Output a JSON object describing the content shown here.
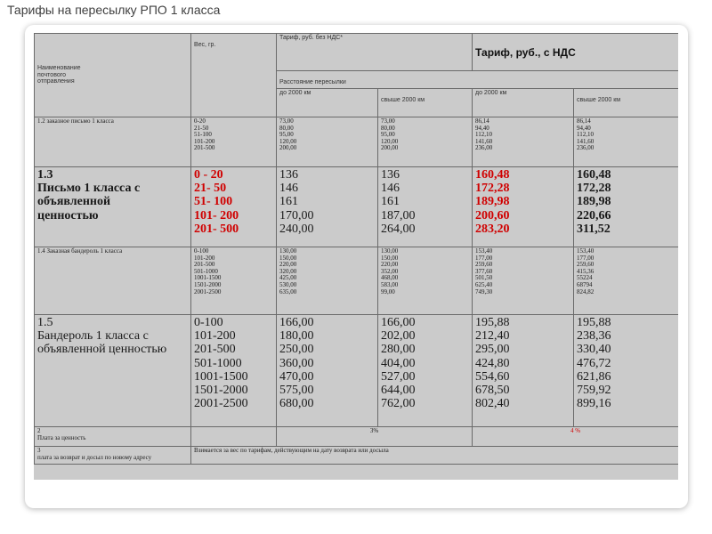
{
  "title": "Тарифы на пересылку РПО 1 класса",
  "header": {
    "name_col": "Наименование почтового отправления",
    "weight_col": "Вес, гр.",
    "tariff_no_vat": "Тариф, руб. без НДС*",
    "tariff_vat": "Тариф, руб., с НДС",
    "distance": "Расстояние пересылки",
    "d1": "до 2000 км",
    "d2": "свыше 2000 км",
    "d3": "до 2000 км",
    "d4": "свыше 2000 км"
  },
  "rows": {
    "r12": {
      "name": "1.2 заказное письмо 1 класса",
      "weights": [
        "0-20",
        "21-50",
        "51-100",
        "101-200",
        "201-500"
      ],
      "c1": [
        "73,00",
        "80,00",
        "95,00",
        "120,00",
        "200,00"
      ],
      "c2": [
        "73,00",
        "80,00",
        "95,00",
        "120,00",
        "200,00"
      ],
      "c3": [
        "86,14",
        "94,40",
        "112,10",
        "141,60",
        "236,00"
      ],
      "c4": [
        "86,14",
        "94,40",
        "112,10",
        "141,60",
        "236,00"
      ]
    },
    "r13": {
      "num": "1.3",
      "name": "Письмо 1 класса с объявленной ценностью",
      "weights": [
        "0 - 20",
        "21- 50",
        "51- 100",
        "101- 200",
        "201- 500"
      ],
      "c1": [
        "136",
        "146",
        "161",
        "170,00",
        "240,00"
      ],
      "c2": [
        "136",
        "146",
        "161",
        "187,00",
        "264,00"
      ],
      "c3": [
        "160,48",
        "172,28",
        "189,98",
        "200,60",
        "283,20"
      ],
      "c4": [
        "160,48",
        "172,28",
        "189,98",
        "220,66",
        "311,52"
      ]
    },
    "r14": {
      "name": "1.4 Заказная бандероль 1 класса",
      "weights": [
        "0-100",
        "101-200",
        "201-500",
        "501-1000",
        "1001-1500",
        "1501-2000",
        "2001-2500"
      ],
      "c1": [
        "130,00",
        "150,00",
        "220,00",
        "320,00",
        "425,00",
        "530,00",
        "635,00"
      ],
      "c2": [
        "130,00",
        "150,00",
        "220,00",
        "352,00",
        "468,00",
        "583,00",
        "99,00"
      ],
      "c3": [
        "153,40",
        "177,00",
        "259,60",
        "377,60",
        "501,50",
        "625,40",
        "749,30"
      ],
      "c4": [
        "153,40",
        "177,00",
        "259,60",
        "415,36",
        "55224",
        "68794",
        "824,82"
      ]
    },
    "r15": {
      "num": "1.5",
      "name": "Бандероль 1 класса с объявленной ценностью",
      "weights": [
        "0-100",
        "101-200",
        "201-500",
        "501-1000",
        "1001-1500",
        "1501-2000",
        "2001-2500"
      ],
      "c1": [
        "166,00",
        "180,00",
        "250,00",
        "360,00",
        "470,00",
        "575,00",
        "680,00"
      ],
      "c2": [
        "166,00",
        "202,00",
        "280,00",
        "404,00",
        "527,00",
        "644,00",
        "762,00"
      ],
      "c3": [
        "195,88",
        "212,40",
        "295,00",
        "424,80",
        "554,60",
        "678,50",
        "802,40"
      ],
      "c4": [
        "195,88",
        "238,36",
        "330,40",
        "476,72",
        "621,86",
        "759,92",
        "899,16"
      ]
    },
    "r2": {
      "num": "2",
      "name": "Плата за ценность",
      "no_vat": "3%",
      "vat": "4 %"
    },
    "r3": {
      "num": "3",
      "name": "плата за возврат и досыл по новому адресу",
      "text": "Взимается за вес по тарифам, действующим на дату возврата или досыла"
    }
  }
}
